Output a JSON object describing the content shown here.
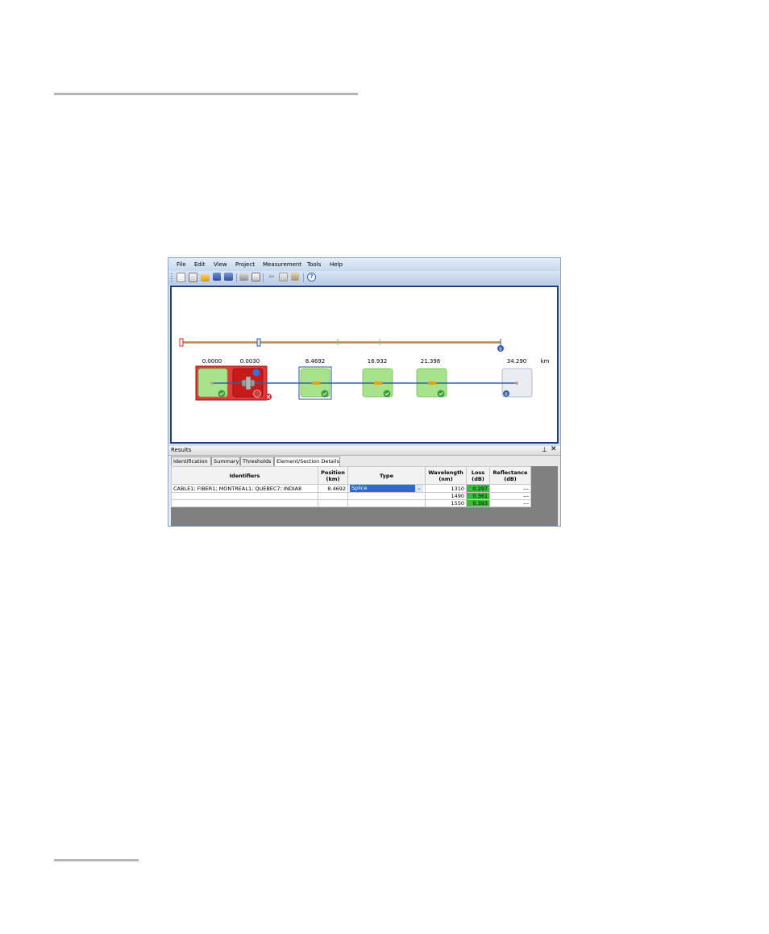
{
  "menu": [
    "File",
    "Edit",
    "View",
    "Project",
    "Measurement",
    "Tools",
    "Help"
  ],
  "toolbar_icons": [
    "new-icon",
    "new-project-icon",
    "open-icon",
    "save-icon",
    "save-all-icon",
    "print-icon",
    "print-preview-icon",
    "cut-icon",
    "copy-icon",
    "paste-icon",
    "help-icon"
  ],
  "map": {
    "unit": "km",
    "positions": [
      "0.0000",
      "0.0030",
      "8.4692",
      "16.932",
      "21.398",
      "34.290"
    ],
    "colors": {
      "pass": "#a8e28a",
      "fail": "#d8222a",
      "fiber": "#2f5fb0",
      "span": "#c9a47a"
    }
  },
  "results": {
    "title": "Results",
    "tabs": [
      "Identification",
      "Summary",
      "Thresholds",
      "Element/Section Details"
    ],
    "active_tab": "Element/Section Details",
    "columns": {
      "identifiers": "Identifiers",
      "position": "Position (km)",
      "type": "Type",
      "wavelength": "Wavelength (nm)",
      "loss": "Loss (dB)",
      "reflectance": "Reflectance (dB)"
    },
    "row": {
      "identifiers": "CABLE1; FIBER1; MONTREAL1; QUEBEC7; INDIA8",
      "position": "8.4692",
      "type": "Splice"
    },
    "measurements": [
      {
        "wavelength": "1310",
        "loss": "0.297",
        "reflectance": "---"
      },
      {
        "wavelength": "1490",
        "loss": "0.361",
        "reflectance": "---"
      },
      {
        "wavelength": "1550",
        "loss": "0.393",
        "reflectance": "---"
      }
    ]
  }
}
